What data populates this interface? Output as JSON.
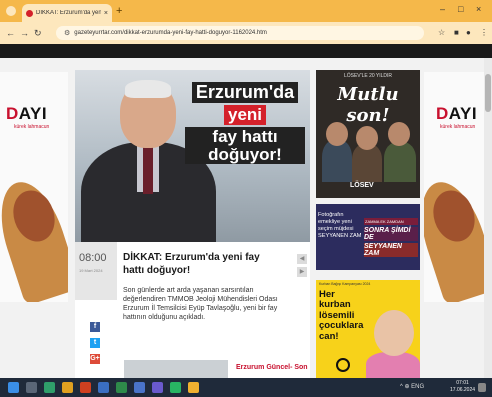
{
  "browser": {
    "tab_title": "DİKKAT: Erzurum'da yeni fay h",
    "tab_close": "×",
    "new_tab": "+",
    "window_controls": [
      "–",
      "□",
      "×"
    ],
    "url": "gazeteyurrtar.com/dikkat-erzurumda-yeni-fay-hatti-doguyor-1162024.htm"
  },
  "side_ads": {
    "brand_prefix": "D",
    "brand_rest": "AYI",
    "sub": "kürek lahmacun"
  },
  "hero": {
    "title_line1": "Erzurum'da",
    "title_line2": "yeni",
    "title_line3": "fay hattı doğuyor!"
  },
  "article": {
    "time": "08:00",
    "date": "19 Mart 2024",
    "title": "DİKKAT: Erzurum'da yeni fay hattı doğuyor!",
    "body": "Son günlerde art arda yaşanan sarsıntıları değerlendiren TMMOB Jeoloji Mühendisleri Odası Erzurum İl Temsilcisi Eyüp Tavlaşoğlu, yeni bir fay hattının olduğunu açıkladı.",
    "related": "Erzurum Güncel- Son"
  },
  "share": {
    "facebook": "f",
    "twitter": "t",
    "google": "G+"
  },
  "ads": {
    "losev_top": "LÖSEV'LE 20 YILDIR",
    "losev_title": "Mutlu son!",
    "losev_logo": "LÖSEV",
    "ad2_left": "Fotoğrafın emekliye yeni seçim müjdesi SEYYANEN ZAM",
    "ad2_small": "ZAMMA EK ZAMDAN",
    "ad2_big1": "SONRA ŞİMDİ DE",
    "ad2_big2": "SEYYANEN ZAM",
    "ad3_top": "Kurban Bağışı Kampanyası 2024",
    "ad3_title": "Her kurban lösemili çocuklara can!"
  },
  "taskbar": {
    "time": "07:01",
    "date": "17.06.2024",
    "tray": "^ ⊕ ENG"
  },
  "colors": {
    "chrome": "#f5b84a",
    "accent_red": "#c8102e",
    "dark": "#1a1a1a",
    "ad_yellow": "#f7d21a"
  }
}
